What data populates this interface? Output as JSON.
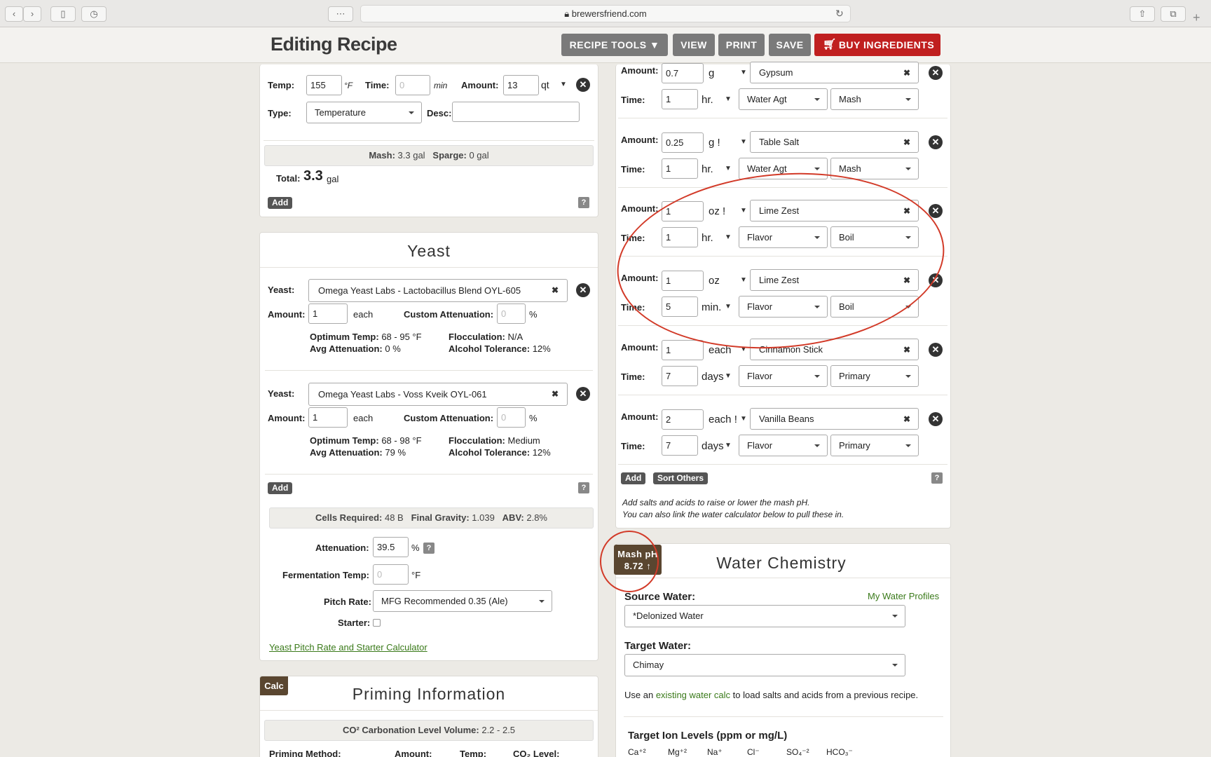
{
  "browser": {
    "url": "brewersfriend.com"
  },
  "header": {
    "title": "Editing Recipe",
    "buttons": [
      "RECIPE TOOLS ▼",
      "VIEW",
      "PRINT",
      "SAVE",
      "BUY INGREDIENTS"
    ]
  },
  "mash_step": {
    "temp_label": "Temp:",
    "temp": "155",
    "temp_unit": "°F",
    "time_label": "Time:",
    "time_placeholder": "0",
    "time_unit": "min",
    "amount_label": "Amount:",
    "amount": "13",
    "amount_unit": "qt",
    "type_label": "Type:",
    "type": "Temperature",
    "desc_label": "Desc:",
    "summary_mash_label": "Mash:",
    "summary_mash": "3.3 gal",
    "summary_sparge_label": "Sparge:",
    "summary_sparge": "0 gal",
    "total_label": "Total:",
    "total_value": "3.3",
    "total_unit": "gal",
    "add": "Add",
    "help": "?"
  },
  "yeast": {
    "title": "Yeast",
    "items": [
      {
        "label": "Yeast:",
        "name": "Omega Yeast Labs - Lactobacillus Blend OYL-605",
        "amount_label": "Amount:",
        "amount": "1",
        "unit": "each",
        "custom_label": "Custom Attenuation:",
        "custom_placeholder": "0",
        "pct": "%",
        "opt_label": "Optimum Temp:",
        "opt": "68 - 95 °F",
        "avg_label": "Avg Attenuation:",
        "avg": "0 %",
        "floc_label": "Flocculation:",
        "floc": "N/A",
        "alc_label": "Alcohol Tolerance:",
        "alc": "12%"
      },
      {
        "label": "Yeast:",
        "name": "Omega Yeast Labs - Voss Kveik OYL-061",
        "amount_label": "Amount:",
        "amount": "1",
        "unit": "each",
        "custom_label": "Custom Attenuation:",
        "custom_placeholder": "0",
        "pct": "%",
        "opt_label": "Optimum Temp:",
        "opt": "68 - 98 °F",
        "avg_label": "Avg Attenuation:",
        "avg": "79 %",
        "floc_label": "Flocculation:",
        "floc": "Medium",
        "alc_label": "Alcohol Tolerance:",
        "alc": "12%"
      }
    ],
    "add": "Add",
    "help": "?",
    "cells_label": "Cells Required:",
    "cells": "48 B",
    "fg_label": "Final Gravity:",
    "fg": "1.039",
    "abv_label": "ABV:",
    "abv": "2.8%",
    "atten_label": "Attenuation:",
    "atten": "39.5",
    "atten_unit": "%",
    "ferm_label": "Fermentation Temp:",
    "ferm_placeholder": "0",
    "ferm_unit": "°F",
    "pitch_label": "Pitch Rate:",
    "pitch": "MFG Recommended 0.35 (Ale)",
    "starter_label": "Starter:",
    "calc_link": "Yeast Pitch Rate and Starter Calculator"
  },
  "priming": {
    "calc": "Calc",
    "title": "Priming Information",
    "co2_label": "CO² Carbonation Level Volume:",
    "co2": "2.2 - 2.5",
    "cols": [
      "Priming Method:",
      "Amount:",
      "Temp:",
      "CO₂ Level:"
    ]
  },
  "others": {
    "items": [
      {
        "amount_label": "Amount:",
        "amount": "0.7",
        "unit": "g",
        "name": "Gypsum",
        "time_label": "Time:",
        "time": "1",
        "time_unit": "hr.",
        "use": "Water Agt",
        "stage": "Mash"
      },
      {
        "amount_label": "Amount:",
        "amount": "0.25",
        "unit": "g !",
        "name": "Table Salt",
        "time_label": "Time:",
        "time": "1",
        "time_unit": "hr.",
        "use": "Water Agt",
        "stage": "Mash"
      },
      {
        "amount_label": "Amount:",
        "amount": "1",
        "unit": "oz !",
        "name": "Lime Zest",
        "time_label": "Time:",
        "time": "1",
        "time_unit": "hr.",
        "use": "Flavor",
        "stage": "Boil"
      },
      {
        "amount_label": "Amount:",
        "amount": "1",
        "unit": "oz",
        "name": "Lime Zest",
        "time_label": "Time:",
        "time": "5",
        "time_unit": "min.",
        "use": "Flavor",
        "stage": "Boil"
      },
      {
        "amount_label": "Amount:",
        "amount": "1",
        "unit": "each",
        "name": "Cinnamon Stick",
        "time_label": "Time:",
        "time": "7",
        "time_unit": "days",
        "use": "Flavor",
        "stage": "Primary"
      },
      {
        "amount_label": "Amount:",
        "amount": "2",
        "unit": "each !",
        "name": "Vanilla Beans",
        "time_label": "Time:",
        "time": "7",
        "time_unit": "days",
        "use": "Flavor",
        "stage": "Primary"
      }
    ],
    "add": "Add",
    "sort": "Sort Others",
    "help": "?",
    "note1": "Add salts and acids to raise or lower the mash pH.",
    "note2": "You can also link the water calculator below to pull these in."
  },
  "water": {
    "ph_label": "Mash pH",
    "ph_value": "8.72 ↑",
    "title": "Water Chemistry",
    "source_label": "Source Water:",
    "profiles_link": "My Water Profiles",
    "source": "*Delonized Water",
    "target_label": "Target Water:",
    "target": "Chimay",
    "use_prefix": "Use an",
    "use_link": "existing water calc",
    "use_suffix": "to load salts and acids from a previous recipe.",
    "ion_title": "Target Ion Levels (ppm or mg/L)",
    "ions": [
      "Ca⁺²",
      "Mg⁺²",
      "Na⁺",
      "Cl⁻",
      "SO₄⁻²",
      "HCO₃⁻"
    ]
  },
  "colors": {
    "accent_red": "#c01f1f",
    "annotation_red": "#d23a28",
    "ph_badge": "#5a4630",
    "link_green": "#3a7a1a"
  }
}
